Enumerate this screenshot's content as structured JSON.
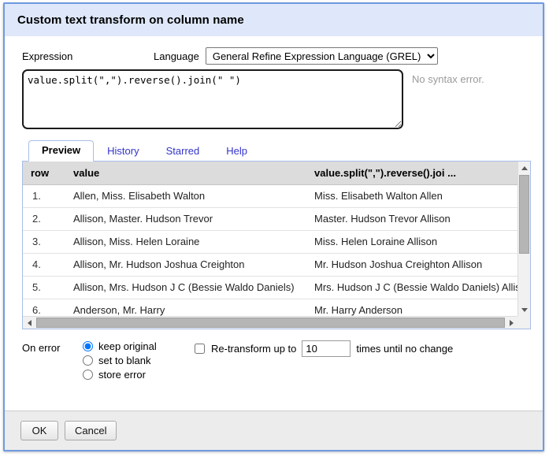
{
  "dialog": {
    "title": "Custom text transform on column name"
  },
  "expression": {
    "label": "Expression",
    "language_label": "Language",
    "language_selected": "General Refine Expression Language (GREL)",
    "language_options": [
      "General Refine Expression Language (GREL)"
    ],
    "value": "value.split(\",\").reverse().join(\" \")",
    "placeholder": "",
    "syntax_status": "No syntax error."
  },
  "tabs": [
    {
      "label": "Preview",
      "active": true
    },
    {
      "label": "History",
      "active": false
    },
    {
      "label": "Starred",
      "active": false
    },
    {
      "label": "Help",
      "active": false
    }
  ],
  "preview": {
    "columns": [
      "row",
      "value",
      "value.split(\",\").reverse().joi ..."
    ],
    "rows": [
      {
        "row": "1.",
        "value": "Allen, Miss. Elisabeth Walton",
        "result": "Miss. Elisabeth Walton Allen"
      },
      {
        "row": "2.",
        "value": "Allison, Master. Hudson Trevor",
        "result": "Master. Hudson Trevor Allison"
      },
      {
        "row": "3.",
        "value": "Allison, Miss. Helen Loraine",
        "result": "Miss. Helen Loraine Allison"
      },
      {
        "row": "4.",
        "value": "Allison, Mr. Hudson Joshua Creighton",
        "result": "Mr. Hudson Joshua Creighton Allison"
      },
      {
        "row": "5.",
        "value": "Allison, Mrs. Hudson J C (Bessie Waldo Daniels)",
        "result": "Mrs. Hudson J C (Bessie Waldo Daniels) Allison"
      },
      {
        "row": "6.",
        "value": "Anderson, Mr. Harry",
        "result": "Mr. Harry Anderson"
      }
    ]
  },
  "on_error": {
    "label": "On error",
    "options": [
      {
        "label": "keep original",
        "selected": true
      },
      {
        "label": "set to blank",
        "selected": false
      },
      {
        "label": "store error",
        "selected": false
      }
    ],
    "retransform": {
      "checked": false,
      "prefix_label": "Re-transform up to",
      "times_value": "10",
      "suffix_label": "times until no change"
    }
  },
  "footer": {
    "ok_label": "OK",
    "cancel_label": "Cancel"
  },
  "colors": {
    "titlebar_bg": "#dfe8fa",
    "dialog_border": "#6f9ae0",
    "tab_link": "#3333cc",
    "table_header_bg": "#dcdcdc",
    "footer_bg": "#ececec",
    "syntax_ok_text": "#9a9a9a",
    "radio_accent": "#1a73e8"
  }
}
